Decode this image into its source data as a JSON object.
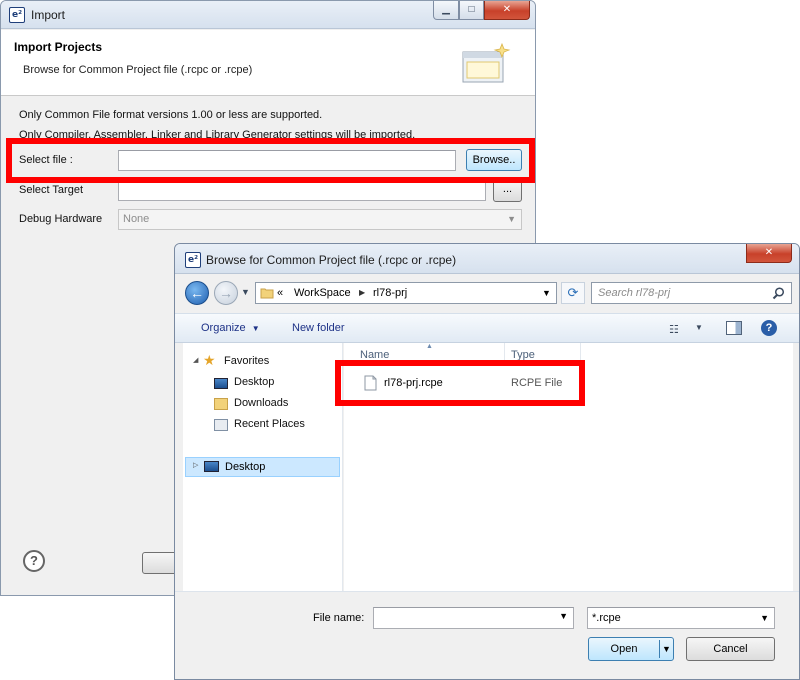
{
  "import_dialog": {
    "window_title": "Import",
    "header_title": "Import Projects",
    "header_subtitle": "Browse for Common Project file (.rcpc or .rcpe)",
    "info_line1": "Only Common File format versions 1.00 or less are supported.",
    "info_line2": "Only Compiler, Assembler, Linker and Library Generator settings will be imported.",
    "select_file_label": "Select file :",
    "select_file_value": "",
    "browse_button": "Browse..",
    "select_target_label": "Select Target",
    "select_target_value": "",
    "target_button": "...",
    "debug_hardware_label": "Debug Hardware",
    "debug_hardware_value": "None",
    "help_symbol": "?"
  },
  "browse_dialog": {
    "window_title": "Browse for Common Project file (.rcpc or .rcpe)",
    "breadcrumb": {
      "overflow": "«",
      "items": [
        "WorkSpace",
        "rl78-prj"
      ]
    },
    "search_placeholder": "Search rl78-prj",
    "toolbar": {
      "organize": "Organize",
      "new_folder": "New folder"
    },
    "nav_tree": {
      "favorites": "Favorites",
      "items": [
        "Desktop",
        "Downloads",
        "Recent Places"
      ],
      "root_selected": "Desktop"
    },
    "columns": {
      "name": "Name",
      "type": "Type"
    },
    "files": [
      {
        "name": "rl78-prj.rcpe",
        "type": "RCPE File"
      }
    ],
    "file_name_label": "File name:",
    "file_name_value": "",
    "filter_value": "*.rcpe",
    "open_button": "Open",
    "cancel_button": "Cancel"
  },
  "colors": {
    "highlight_box": "#ff0000",
    "link_blue": "#1e3287",
    "selection_blue": "#cce8ff"
  }
}
